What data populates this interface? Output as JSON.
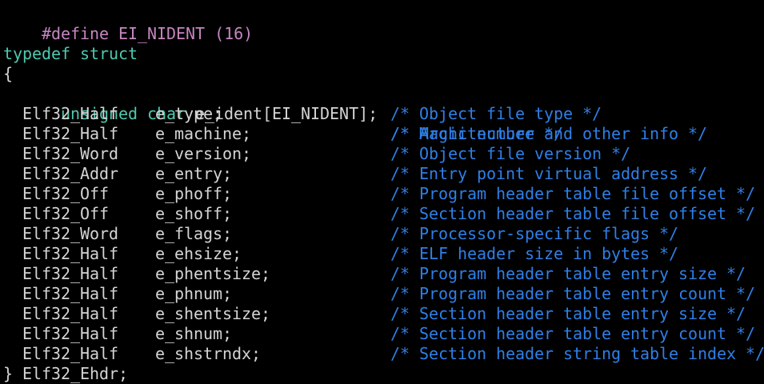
{
  "code": {
    "define_line": {
      "directive": "#define",
      "name": "EI_NIDENT",
      "value": "(16)"
    },
    "typedef_line": "typedef struct",
    "open_brace": "{",
    "first_field": {
      "keyword": "unsigned char",
      "decl": "e_ident[EI_NIDENT];",
      "comment": "/* Magic number and other info */"
    },
    "fields": [
      {
        "type": "Elf32_Half",
        "name": "e_type;",
        "comment": "/* Object file type */"
      },
      {
        "type": "Elf32_Half",
        "name": "e_machine;",
        "comment": "/* Architecture */"
      },
      {
        "type": "Elf32_Word",
        "name": "e_version;",
        "comment": "/* Object file version */"
      },
      {
        "type": "Elf32_Addr",
        "name": "e_entry;",
        "comment": "/* Entry point virtual address */"
      },
      {
        "type": "Elf32_Off",
        "name": "e_phoff;",
        "comment": "/* Program header table file offset */"
      },
      {
        "type": "Elf32_Off",
        "name": "e_shoff;",
        "comment": "/* Section header table file offset */"
      },
      {
        "type": "Elf32_Word",
        "name": "e_flags;",
        "comment": "/* Processor-specific flags */"
      },
      {
        "type": "Elf32_Half",
        "name": "e_ehsize;",
        "comment": "/* ELF header size in bytes */"
      },
      {
        "type": "Elf32_Half",
        "name": "e_phentsize;",
        "comment": "/* Program header table entry size */"
      },
      {
        "type": "Elf32_Half",
        "name": "e_phnum;",
        "comment": "/* Program header table entry count */"
      },
      {
        "type": "Elf32_Half",
        "name": "e_shentsize;",
        "comment": "/* Section header table entry size */"
      },
      {
        "type": "Elf32_Half",
        "name": "e_shnum;",
        "comment": "/* Section header table entry count */"
      },
      {
        "type": "Elf32_Half",
        "name": "e_shstrndx;",
        "comment": "/* Section header string table index */"
      }
    ],
    "closing_line": "} Elf32_Ehdr;"
  },
  "colors": {
    "background": "#000000",
    "preprocessor": "#c586c0",
    "keyword": "#4ec9b0",
    "identifier": "#d4d4d4",
    "comment": "#2f7fe6"
  }
}
